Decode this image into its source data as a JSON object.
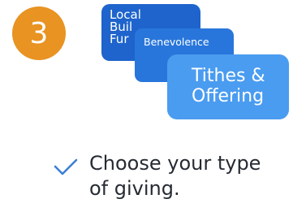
{
  "step": {
    "number": "3",
    "circle_color": "#e89322"
  },
  "cards": {
    "local": {
      "lines": [
        "Local",
        "Buil",
        "Fur"
      ],
      "color": "#1e64cc"
    },
    "benevolence": {
      "label": "Benevolence",
      "color": "#2876db"
    },
    "tithes": {
      "lines": [
        "Tithes &",
        "Offering"
      ],
      "color": "#4a9cf0"
    }
  },
  "instruction": {
    "lines": [
      "Choose your type",
      "of giving."
    ],
    "check_icon": "checkmark-icon",
    "check_color": "#3b7fd6"
  }
}
